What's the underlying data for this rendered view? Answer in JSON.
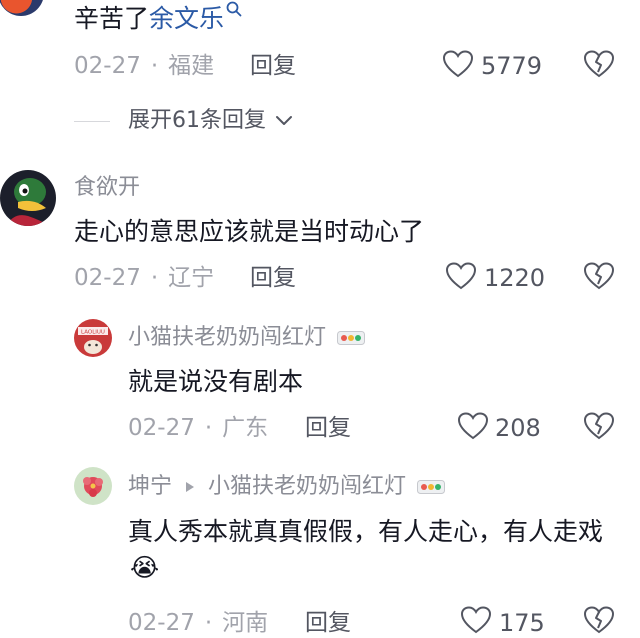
{
  "comments": [
    {
      "text_prefix": "辛苦了",
      "mention": "余文乐",
      "date": "02-27",
      "location": "福建",
      "reply_label": "回复",
      "likes": "5779",
      "expand_label": "展开61条回复"
    },
    {
      "username": "食欲开",
      "text": "走心的意思应该就是当时动心了",
      "date": "02-27",
      "location": "辽宁",
      "reply_label": "回复",
      "likes": "1220"
    }
  ],
  "replies": [
    {
      "username": "小猫扶老奶奶闯红灯",
      "avatar_text": "LAOLIUU",
      "text": "就是说没有剧本",
      "date": "02-27",
      "location": "广东",
      "reply_label": "回复",
      "likes": "208"
    },
    {
      "username": "坤宁",
      "reply_to": "小猫扶老奶奶闯红灯",
      "text": "真人秀本就真真假假，有人走心，有人走戏",
      "emoji": "😭",
      "date": "02-27",
      "location": "河南",
      "reply_label": "回复",
      "likes": "175"
    }
  ],
  "separator": "·",
  "colors": {
    "text": "#161823",
    "meta": "#a1a3ab",
    "mention": "#2b5aa6"
  },
  "icons": [
    "heart-icon",
    "broken-heart-icon",
    "chevron-down-icon",
    "search-icon",
    "traffic-light-badge-icon",
    "reply-arrow-icon"
  ]
}
